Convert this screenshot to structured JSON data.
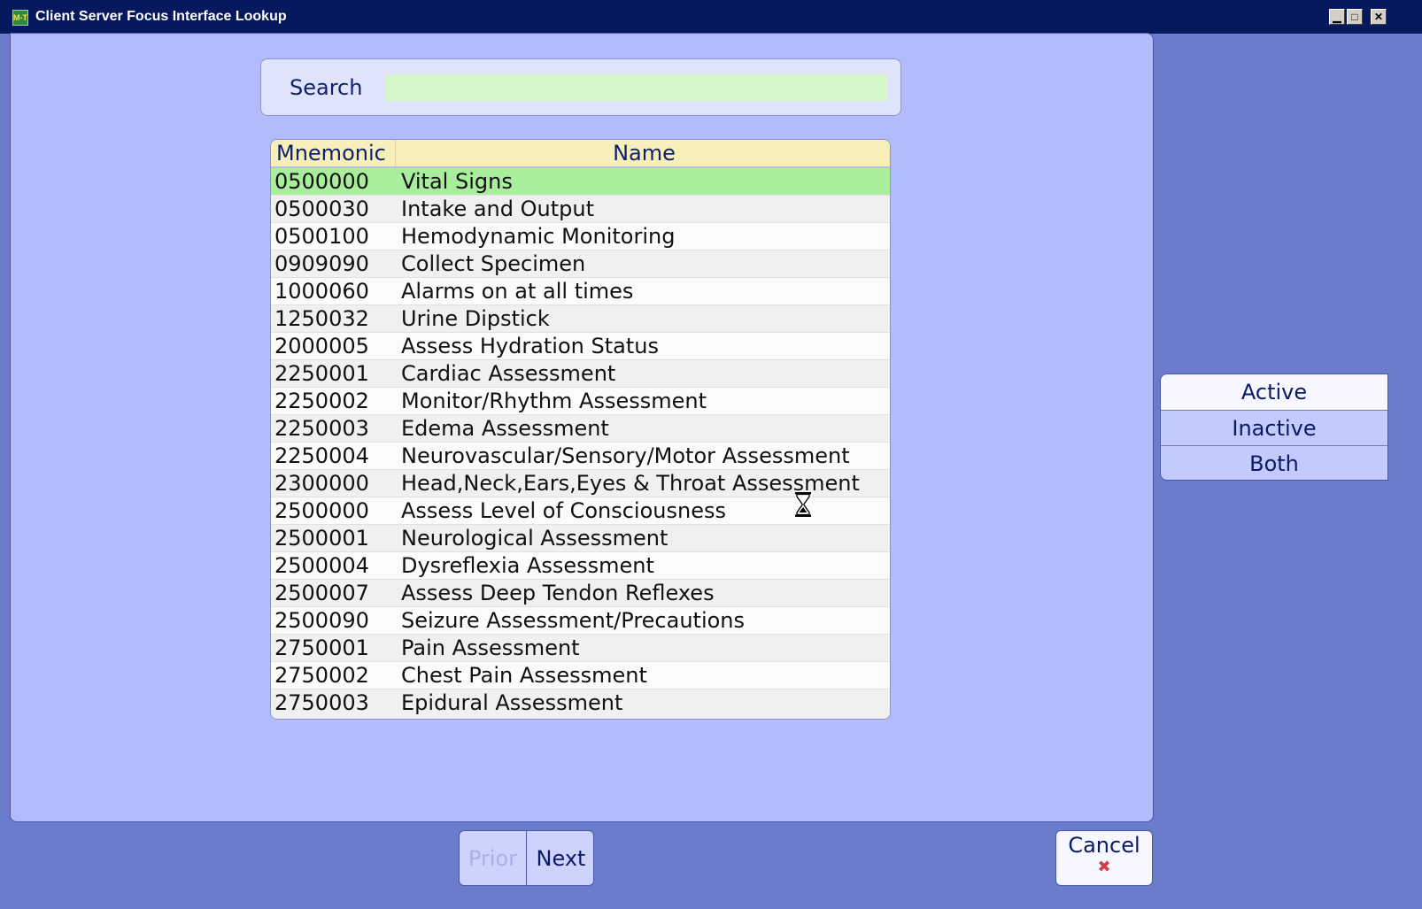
{
  "window": {
    "title": "Client Server Focus Interface Lookup",
    "icon_text": "M‐T",
    "minimize": "▁",
    "maximize": "□",
    "close": "✕"
  },
  "search": {
    "label": "Search",
    "value": ""
  },
  "grid": {
    "columns": [
      "Mnemonic",
      "Name"
    ],
    "rows": [
      {
        "mnemonic": "0500000",
        "name": "Vital Signs"
      },
      {
        "mnemonic": "0500030",
        "name": "Intake and Output"
      },
      {
        "mnemonic": "0500100",
        "name": "Hemodynamic Monitoring"
      },
      {
        "mnemonic": "0909090",
        "name": "Collect Specimen"
      },
      {
        "mnemonic": "1000060",
        "name": "Alarms on at all times"
      },
      {
        "mnemonic": "1250032",
        "name": "Urine Dipstick"
      },
      {
        "mnemonic": "2000005",
        "name": "Assess Hydration Status"
      },
      {
        "mnemonic": "2250001",
        "name": "Cardiac Assessment"
      },
      {
        "mnemonic": "2250002",
        "name": "Monitor/Rhythm Assessment"
      },
      {
        "mnemonic": "2250003",
        "name": "Edema Assessment"
      },
      {
        "mnemonic": "2250004",
        "name": "Neurovascular/Sensory/Motor Assessment"
      },
      {
        "mnemonic": "2300000",
        "name": "Head,Neck,Ears,Eyes & Throat Assessment"
      },
      {
        "mnemonic": "2500000",
        "name": "Assess Level of Consciousness"
      },
      {
        "mnemonic": "2500001",
        "name": "Neurological Assessment"
      },
      {
        "mnemonic": "2500004",
        "name": "Dysreflexia Assessment"
      },
      {
        "mnemonic": "2500007",
        "name": "Assess Deep Tendon Reflexes"
      },
      {
        "mnemonic": "2500090",
        "name": "Seizure Assessment/Precautions"
      },
      {
        "mnemonic": "2750001",
        "name": "Pain Assessment"
      },
      {
        "mnemonic": "2750002",
        "name": "Chest Pain Assessment"
      },
      {
        "mnemonic": "2750003",
        "name": "Epidural Assessment"
      }
    ],
    "selected_index": 0
  },
  "filters": {
    "active": "Active",
    "inactive": "Inactive",
    "both": "Both"
  },
  "pager": {
    "prior": "Prior",
    "next": "Next"
  },
  "cancel": {
    "label": "Cancel",
    "icon": "✖"
  },
  "colors": {
    "titlebar": "#06195e",
    "panel": "#b3bcfb",
    "background": "#6b7ccd",
    "selected_row": "#a9ee9d",
    "search_field": "#d6f8c8",
    "grid_header": "#f6efb9"
  }
}
